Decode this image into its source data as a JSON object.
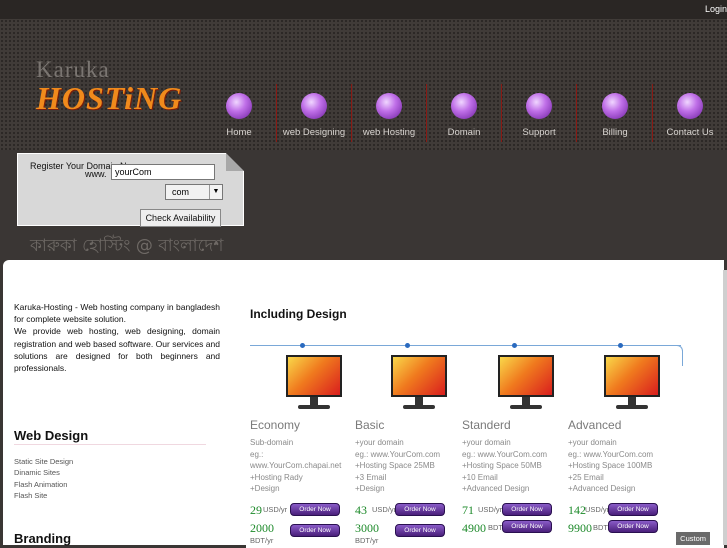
{
  "topbar": {
    "login_label": "Login"
  },
  "logo": {
    "line1": "Karuka",
    "line2": "HOSTiNG"
  },
  "nav": [
    {
      "label": "Home"
    },
    {
      "label": "web Designing"
    },
    {
      "label": "web Hosting"
    },
    {
      "label": "Domain"
    },
    {
      "label": "Support"
    },
    {
      "label": "Billing"
    },
    {
      "label": "Contact Us"
    }
  ],
  "domain_search": {
    "title": "Register Your Domain Name",
    "www_label": "www.",
    "input_value": "yourCom",
    "tld_selected": "com",
    "button_label": "Check Availability"
  },
  "tagline_bangla": "কারুকা হোস্টিং @ বাংলাদেশ",
  "intro": {
    "p1": "Karuka-Hosting - Web hosting company in bangladesh for complete website solution.",
    "p2": "We provide web hosting, web designing, domain registration and web based software. Our services and solutions are designed for both beginners and professionals."
  },
  "web_design": {
    "title": "Web Design",
    "items": [
      "Static Site Design",
      "Dinamic Sites",
      "Flash Animation",
      "Flash Site"
    ]
  },
  "branding_title": "Branding",
  "plans_section": {
    "title": "Including Design",
    "order_label": "Order Now",
    "plans": [
      {
        "name": "Economy",
        "features": [
          "Sub-domain",
          "eg.:",
          "www.YourCom.chapai.net",
          "+Hosting Rady",
          "+Design"
        ],
        "price1": "29",
        "unit1": "USD/yr",
        "price2": "2000",
        "unit2": "BDT/yr"
      },
      {
        "name": "Basic",
        "features": [
          "+your domain",
          "eg.: www.YourCom.com",
          "+Hosting Space 25MB",
          "+3 Email",
          "+Design"
        ],
        "price1": "43",
        "unit1": "USD/yr",
        "price2": "3000",
        "unit2": "BDT/yr"
      },
      {
        "name": "Standerd",
        "features": [
          "+your domain",
          "eg.: www.YourCom.com",
          "+Hosting Space 50MB",
          "+10 Email",
          "+Advanced Design"
        ],
        "price1": "71",
        "unit1": "USD/yr",
        "price2": "4900",
        "unit2": "BDT/yr"
      },
      {
        "name": "Advanced",
        "features": [
          "+your domain",
          "eg.: www.YourCom.com",
          "+Hosting Space 100MB",
          "+25 Email",
          "+Advanced Design"
        ],
        "price1": "142",
        "unit1": "USD/yr",
        "price2": "9900",
        "unit2": "BDT/yr"
      }
    ]
  },
  "custom_label": "Custom"
}
